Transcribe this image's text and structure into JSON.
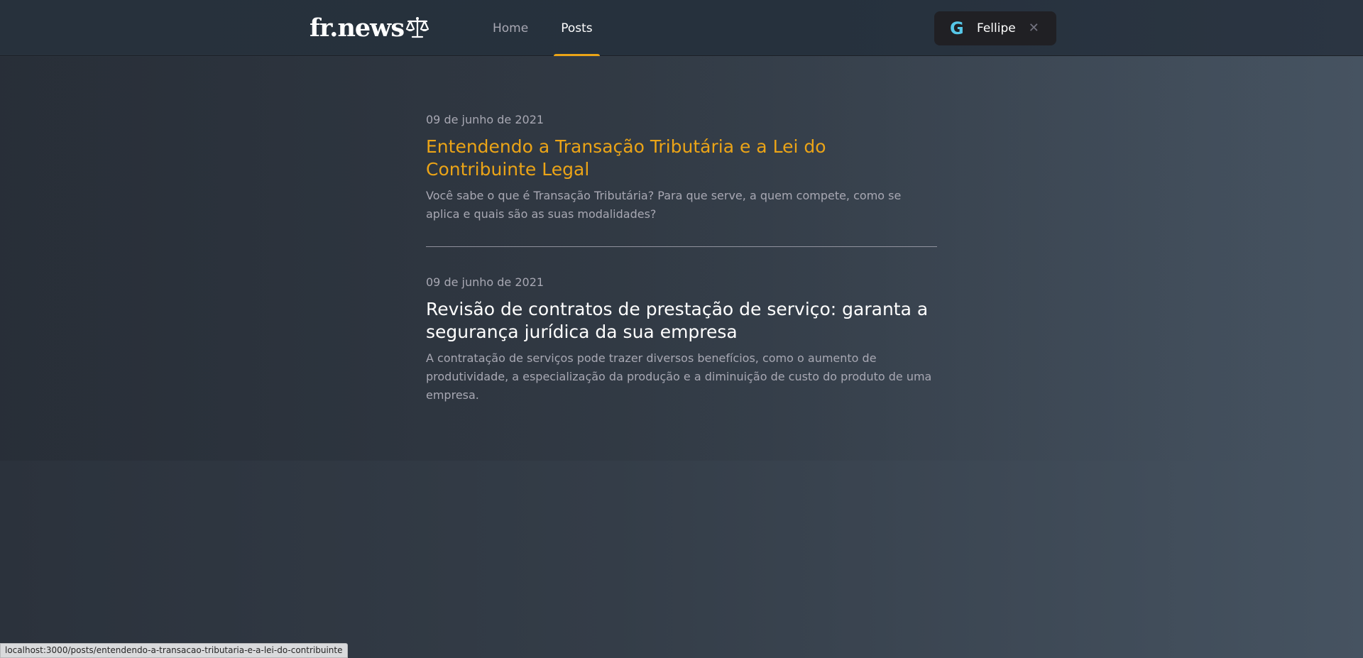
{
  "header": {
    "logo_text": "fr.news",
    "nav": [
      {
        "label": "Home"
      },
      {
        "label": "Posts"
      }
    ],
    "user": {
      "name": "Fellipe",
      "provider_icon": "google-icon",
      "close_icon": "close-icon"
    }
  },
  "posts": [
    {
      "date": "09 de junho de 2021",
      "title": "Entendendo a Transação Tributária e a Lei do Contribuinte Legal",
      "excerpt": "Você sabe o que é Transação Tributária? Para que serve, a quem compete, como se aplica e quais são as suas modalidades?"
    },
    {
      "date": "09 de junho de 2021",
      "title": "Revisão de contratos de prestação de serviço: garanta a segurança jurídica da sua empresa",
      "excerpt": "A contratação de serviços pode trazer diversos benefícios, como o aumento de produtividade, a especialização da produção e a diminuição de custo do produto de uma empresa."
    }
  ],
  "status_bar": {
    "url": "localhost:3000/posts/entendendo-a-transacao-tributaria-e-a-lei-do-contribuinte"
  },
  "colors": {
    "accent": "#eba417",
    "header_bg": "#27313c",
    "button_bg": "#202024",
    "text_muted": "#a8a8b3"
  }
}
